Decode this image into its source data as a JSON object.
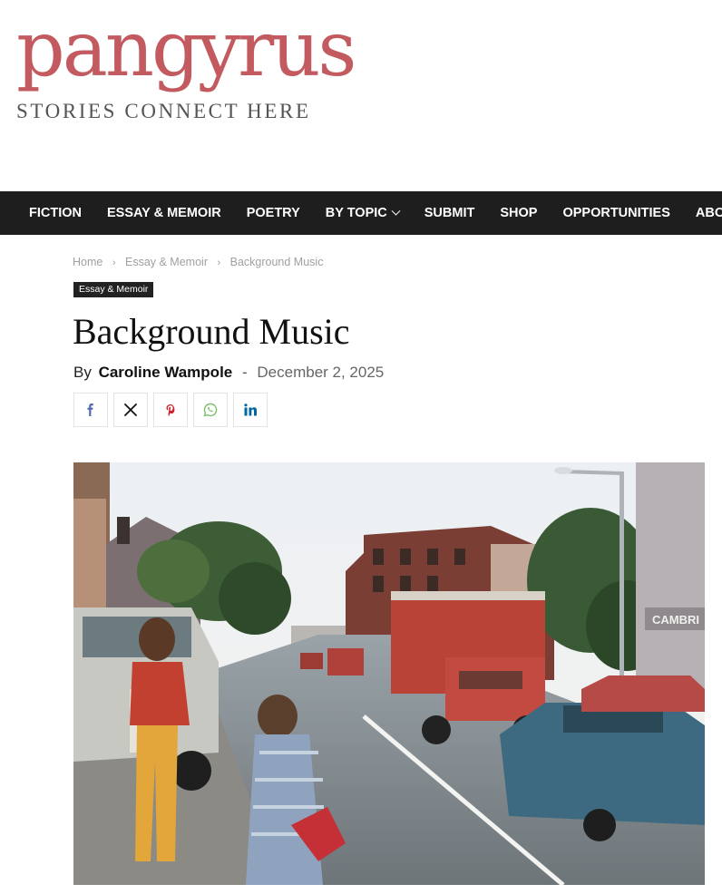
{
  "site": {
    "logo_text": "pangyrus",
    "tagline": "STORIES CONNECT HERE"
  },
  "nav": {
    "items": [
      "FICTION",
      "ESSAY & MEMOIR",
      "POETRY",
      "BY TOPIC",
      "SUBMIT",
      "SHOP",
      "OPPORTUNITIES",
      "ABOUT"
    ]
  },
  "breadcrumb": {
    "items": [
      "Home",
      "Essay & Memoir",
      "Background Music"
    ],
    "separator": "›"
  },
  "article": {
    "category": "Essay & Memoir",
    "title": "Background Music",
    "by_label": "By",
    "author": "Caroline Wampole",
    "dash": "-",
    "date": "December 2, 2025"
  },
  "share": {
    "icons": [
      "facebook-icon",
      "x-icon",
      "pinterest-icon",
      "whatsapp-icon",
      "linkedin-icon"
    ]
  },
  "hero": {
    "storefront_sign": "CAMBRI"
  },
  "colors": {
    "brand": "#c25a5f",
    "nav_bg": "#1e1e1e",
    "facebook": "#516eab",
    "pinterest": "#ca212a",
    "whatsapp": "#7bbf6a",
    "linkedin": "#0266a0"
  }
}
